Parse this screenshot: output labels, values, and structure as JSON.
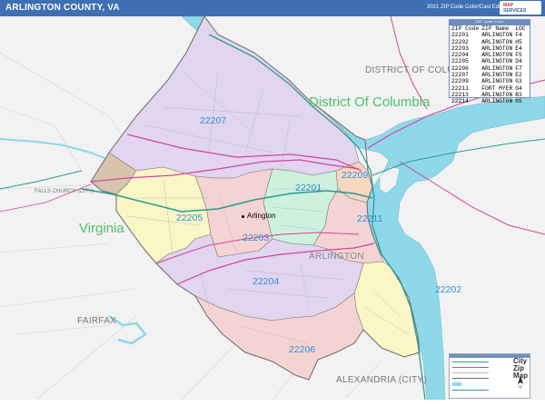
{
  "header": {
    "title": "ARLINGTON COUNTY, VA",
    "edition": "2021 ZIP Code Color/Cast Edition",
    "brand_top": "MAP",
    "brand_bottom": "SERVICES"
  },
  "map": {
    "places": {
      "district_upper": "DISTRICT OF COLUMBIA",
      "district_green": "District Of Columbia",
      "virginia": "Virginia",
      "falls_church": "FALLS CHURCH (CITY)",
      "fairfax": "FAIRFAX",
      "alexandria": "ALEXANDRIA (CITY)",
      "arlington_city": "Arlington",
      "arlington_county": "ARLINGTON"
    },
    "zip_labels": [
      "22207",
      "22209",
      "22201",
      "22205",
      "22211",
      "22203",
      "22204",
      "22202",
      "22206"
    ],
    "colors": {
      "water": "#8ed8ea",
      "purple": "#e1d5f0",
      "yellow": "#fbf6c6",
      "green": "#cdf1dd",
      "salmon": "#f4d4d2",
      "tan": "#d7c4ac",
      "peach": "#f7d7bf",
      "road_magenta": "#d2459c",
      "road_teal": "#2a9d8f",
      "county_line": "#7d7d7d"
    }
  },
  "legend": {
    "title": "ZIP Code List",
    "headers": [
      "ZIP Code",
      "ZIP Name",
      "LOC"
    ],
    "rows": [
      [
        "22201",
        "ARLINGTON",
        "F4"
      ],
      [
        "22202",
        "ARLINGTON",
        "H5"
      ],
      [
        "22203",
        "ARLINGTON",
        "E4"
      ],
      [
        "22204",
        "ARLINGTON",
        "F5"
      ],
      [
        "22205",
        "ARLINGTON",
        "D4"
      ],
      [
        "22206",
        "ARLINGTON",
        "F7"
      ],
      [
        "22207",
        "ARLINGTON",
        "E2"
      ],
      [
        "22209",
        "ARLINGTON",
        "G3"
      ],
      [
        "22211",
        "FORT MYER",
        "G4"
      ],
      [
        "22213",
        "ARLINGTON",
        "B3"
      ],
      [
        "22214",
        "ARLINGTON",
        "G5"
      ]
    ]
  },
  "scale_box": {
    "logo_line1": "City",
    "logo_line2": "Zip",
    "logo_line3": "Map"
  }
}
